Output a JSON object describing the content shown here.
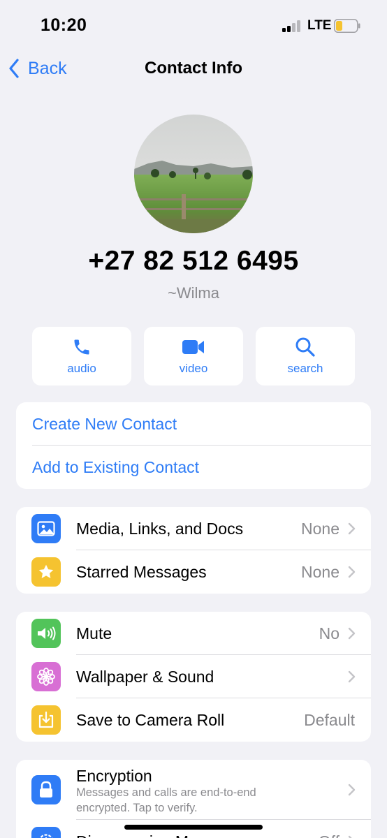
{
  "status": {
    "time": "10:20",
    "network": "LTE"
  },
  "nav": {
    "back_label": "Back",
    "title": "Contact Info"
  },
  "contact": {
    "phone": "+27 82 512 6495",
    "name": "~Wilma"
  },
  "actions": [
    {
      "label": "audio",
      "icon": "phone-icon"
    },
    {
      "label": "video",
      "icon": "video-camera-icon"
    },
    {
      "label": "search",
      "icon": "search-icon"
    }
  ],
  "contact_links": [
    {
      "label": "Create New Contact"
    },
    {
      "label": "Add to Existing Contact"
    }
  ],
  "media_group": [
    {
      "label": "Media, Links, and Docs",
      "value": "None",
      "icon": "photo-icon",
      "color": "#2f7cf6"
    },
    {
      "label": "Starred Messages",
      "value": "None",
      "icon": "star-icon",
      "color": "#f5c330"
    }
  ],
  "settings_group": [
    {
      "label": "Mute",
      "value": "No",
      "icon": "speaker-icon",
      "color": "#52c45a"
    },
    {
      "label": "Wallpaper & Sound",
      "value": "",
      "icon": "flower-icon",
      "color": "#d86fd4"
    },
    {
      "label": "Save to Camera Roll",
      "value": "Default",
      "icon": "download-icon",
      "color": "#f5c330"
    }
  ],
  "security_group": [
    {
      "label": "Encryption",
      "sub1": "Messages and calls are end-to-end",
      "sub2": "encrypted. Tap to verify.",
      "icon": "lock-icon",
      "color": "#2f7cf6"
    },
    {
      "label": "Disappearing Messages",
      "value": "Off",
      "icon": "timer-icon",
      "color": "#2f7cf6"
    }
  ],
  "colors": {
    "accent": "#2e7cf6",
    "background": "#f1f1f6",
    "secondary_text": "#8a8a8e"
  }
}
